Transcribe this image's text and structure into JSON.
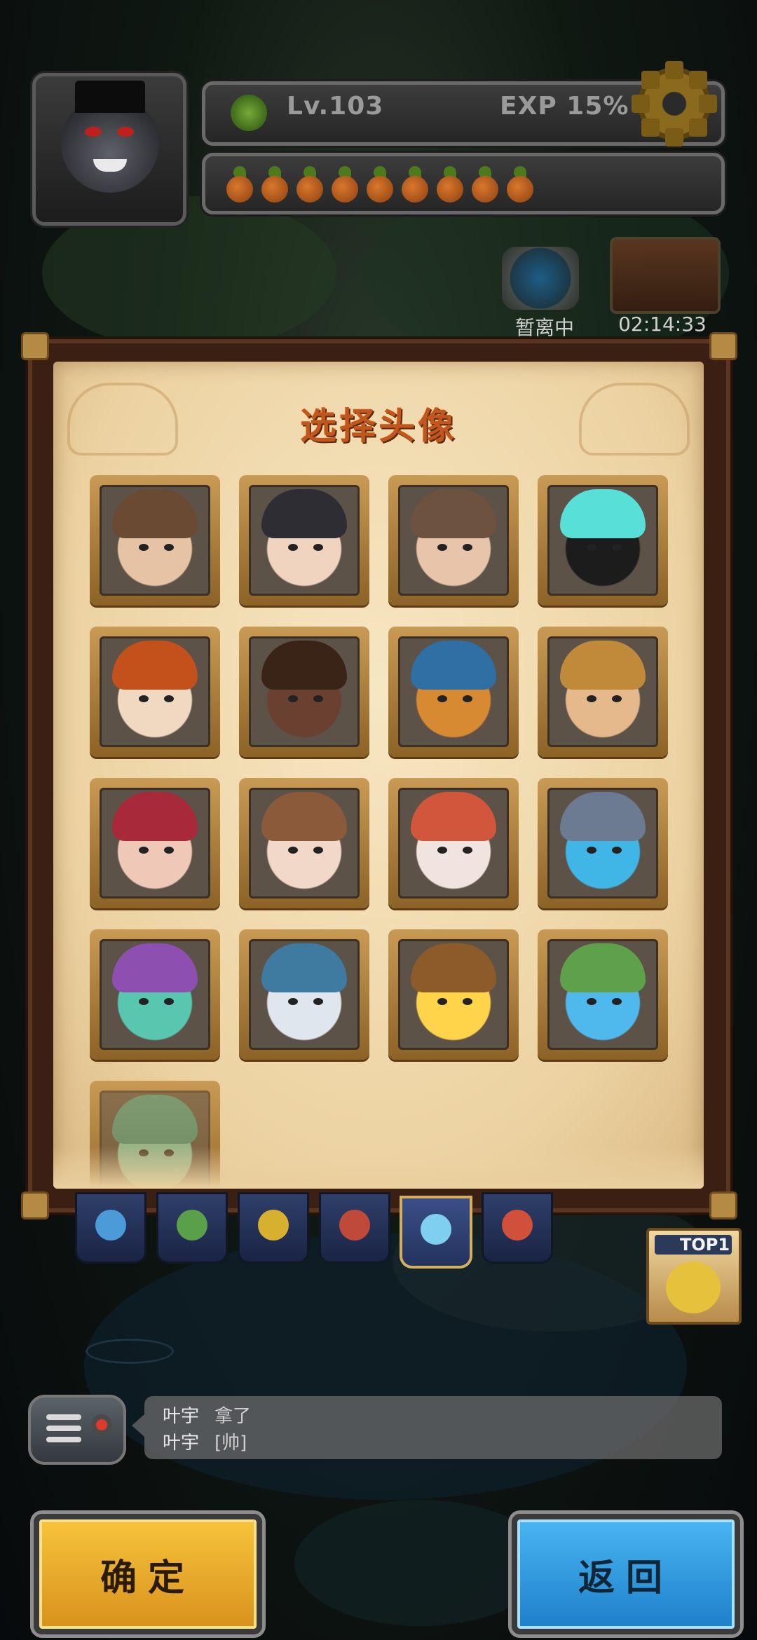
{
  "hud": {
    "level": "Lv.103",
    "exp": "EXP  15%",
    "carrot_count": 9,
    "portal_label": "暂离中",
    "chest_timer": "02:14:33"
  },
  "dialog": {
    "title": "选择头像",
    "avatars": [
      {
        "name": "brown-hair-man"
      },
      {
        "name": "black-hair-man"
      },
      {
        "name": "short-hair-man"
      },
      {
        "name": "spiky-cyan-hair-villain"
      },
      {
        "name": "red-haired-woman"
      },
      {
        "name": "afro-woman"
      },
      {
        "name": "tiger"
      },
      {
        "name": "blonde-warrior-woman"
      },
      {
        "name": "red-haired-girl"
      },
      {
        "name": "veiled-girl"
      },
      {
        "name": "white-fox"
      },
      {
        "name": "blue-knight-creature"
      },
      {
        "name": "green-monster"
      },
      {
        "name": "blue-haired-girl"
      },
      {
        "name": "fruit-hat-bear"
      },
      {
        "name": "blue-robot-blob"
      },
      {
        "name": "green-hair-character"
      }
    ]
  },
  "tabs": [
    {
      "name": "blue-creature"
    },
    {
      "name": "green-creature"
    },
    {
      "name": "yellow-creature"
    },
    {
      "name": "red-creature"
    },
    {
      "name": "question-mark",
      "active": true
    },
    {
      "name": "red-beast"
    }
  ],
  "top_badge": {
    "label": "TOP1"
  },
  "chat": {
    "messages": [
      {
        "user": "叶宇",
        "text": "拿了"
      },
      {
        "user": "叶宇",
        "text": "[帅]"
      }
    ]
  },
  "buttons": {
    "confirm": "确定",
    "back": "返回"
  },
  "colors": {
    "title": "#c2561c",
    "confirm": "#f7c43c",
    "back": "#49b6f2"
  }
}
